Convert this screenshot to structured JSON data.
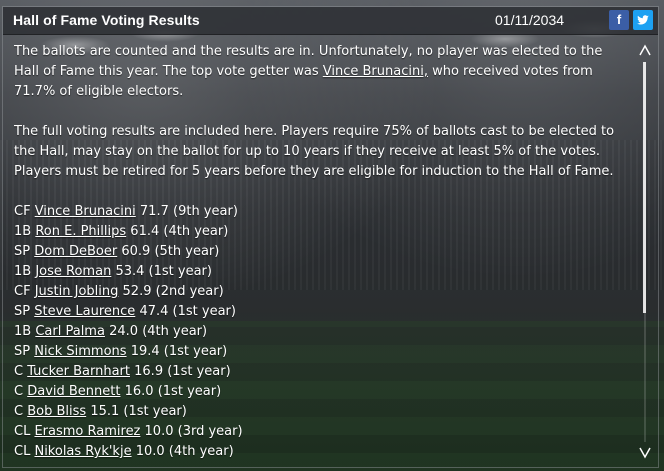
{
  "window": {
    "title": "Hall of Fame Voting Results",
    "date": "01/11/2034",
    "facebook_label": "f"
  },
  "intro": {
    "p1_before": "The ballots are counted and the results are in. Unfortunately, no player was elected to the Hall of Fame this year. The top vote getter was ",
    "p1_link": "Vince Brunacini,",
    "p1_after": " who received votes from 71.7% of eligible electors.",
    "p2": "The full voting results are included here. Players require 75% of ballots cast to be elected to the Hall, may stay on the ballot for up to 10 years if they receive at least 5% of the votes. Players must be retired for 5 years before they are eligible for induction to the Hall of Fame."
  },
  "results": [
    {
      "pos": "CF",
      "name": "Vince Brunacini",
      "pct": "71.7",
      "year": "(9th year)"
    },
    {
      "pos": "1B",
      "name": "Ron E. Phillips",
      "pct": "61.4",
      "year": "(4th year)"
    },
    {
      "pos": "SP",
      "name": "Dom DeBoer",
      "pct": "60.9",
      "year": "(5th year)"
    },
    {
      "pos": "1B",
      "name": "Jose Roman",
      "pct": "53.4",
      "year": "(1st year)"
    },
    {
      "pos": "CF",
      "name": "Justin Jobling",
      "pct": "52.9",
      "year": "(2nd year)"
    },
    {
      "pos": "SP",
      "name": "Steve Laurence",
      "pct": "47.4",
      "year": "(1st year)"
    },
    {
      "pos": "1B",
      "name": "Carl Palma",
      "pct": "24.0",
      "year": "(4th year)"
    },
    {
      "pos": "SP",
      "name": "Nick Simmons",
      "pct": "19.4",
      "year": "(1st year)"
    },
    {
      "pos": "C",
      "name": "Tucker Barnhart",
      "pct": "16.9",
      "year": "(1st year)"
    },
    {
      "pos": "C",
      "name": "David Bennett",
      "pct": "16.0",
      "year": "(1st year)"
    },
    {
      "pos": "C",
      "name": "Bob Bliss",
      "pct": "15.1",
      "year": "(1st year)"
    },
    {
      "pos": "CL",
      "name": "Erasmo Ramirez",
      "pct": "10.0",
      "year": "(3rd year)"
    },
    {
      "pos": "CL",
      "name": "Nikolas Ryk'kje",
      "pct": "10.0",
      "year": "(4th year)"
    }
  ],
  "scrollbar": {
    "thumb_fraction": 0.66,
    "position": 0.0
  },
  "colors": {
    "facebook": "#3b5ea6",
    "twitter": "#1da1f2",
    "titlebar": "#2d3034"
  }
}
